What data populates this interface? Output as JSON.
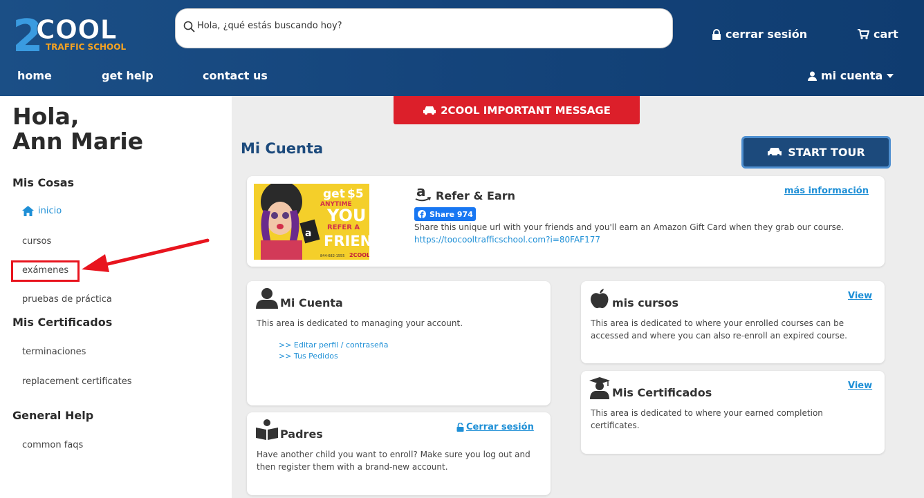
{
  "logo": {
    "main": "2COOL",
    "sub": "TRAFFIC SCHOOL"
  },
  "search": {
    "placeholder": "Hola, ¿qué estás buscando hoy?"
  },
  "header": {
    "logout": "cerrar sesión",
    "cart": "cart",
    "account": "mi cuenta"
  },
  "nav": {
    "home": "home",
    "help": "get help",
    "contact": "contact us"
  },
  "sidebar": {
    "greeting_line1": "Hola,",
    "greeting_line2": "Ann Marie",
    "section1": "Mis Cosas",
    "items1": [
      "inicio",
      "cursos",
      "exámenes",
      "pruebas de práctica"
    ],
    "section2": "Mis Certificados",
    "items2": [
      "terminaciones",
      "replacement certificates"
    ],
    "section3": "General Help",
    "items3": [
      "common faqs"
    ]
  },
  "important_message": "2COOL IMPORTANT MESSAGE",
  "page_title": "Mi Cuenta",
  "start_tour": "START TOUR",
  "promo": {
    "get": "get",
    "amount": "$5",
    "anytime": "ANYTIME",
    "you": "YOU",
    "refer": "REFER A",
    "friend": "FRIEND",
    "phone": "844-682-1555",
    "brand": "2COOL"
  },
  "refer": {
    "title": "Refer & Earn",
    "more_info": "más información",
    "share_label": "Share 974",
    "description": "Share this unique url with your friends and you'll earn an Amazon Gift Card when they grab our course.",
    "url": "https://toocooltrafficschool.com?i=80FAF177"
  },
  "cards": {
    "account": {
      "title": "Mi Cuenta",
      "desc": "This area is dedicated to managing your account.",
      "links": [
        ">> Editar perfil / contraseña",
        ">> Tus Pedidos"
      ]
    },
    "courses": {
      "title": "mis cursos",
      "link": "View",
      "desc_line1": "This area is dedicated to where your enrolled courses can be",
      "desc_line2": "accessed and where you can also re-enroll an expired course."
    },
    "certificates": {
      "title": "Mis Certificados",
      "link": "View",
      "desc_line1": "This area is dedicated to where your earned completion",
      "desc_line2": "certificates."
    },
    "parents": {
      "title": "Padres",
      "link": "Cerrar sesión",
      "desc_line1": "Have another child you want to enroll? Make sure you log out and",
      "desc_line2": "then register them with a brand-new account."
    }
  },
  "colors": {
    "header": "#15457c",
    "accent": "#1e8fd6",
    "alert": "#dc1f2a",
    "highlight": "#e8141e"
  }
}
